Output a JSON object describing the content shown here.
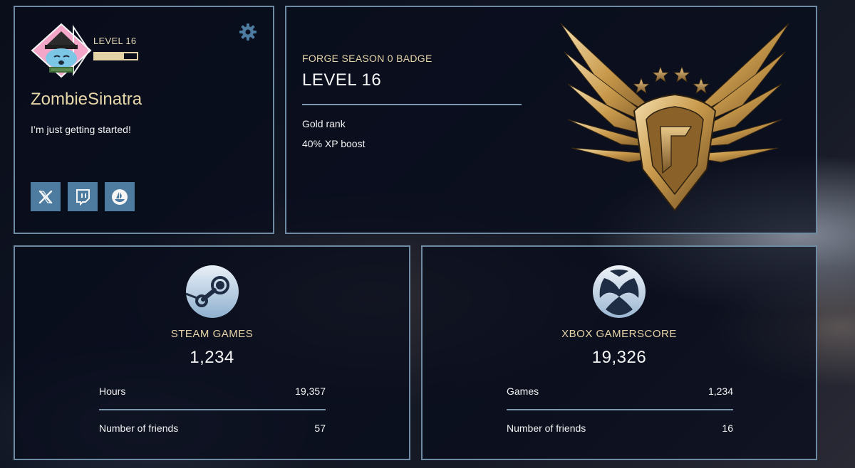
{
  "profile": {
    "level_label": "LEVEL 16",
    "xp_progress": 0.7,
    "username": "ZombieSinatra",
    "bio": "I’m just getting started!",
    "settings_icon": "gear-icon",
    "social_icons": [
      "x-icon",
      "twitch-icon",
      "opensea-icon"
    ]
  },
  "badge": {
    "season": "FORGE SEASON 0 BADGE",
    "level": "LEVEL 16",
    "rank": "Gold rank",
    "boost": "40% XP boost"
  },
  "steam": {
    "icon": "steam-icon",
    "label": "STEAM GAMES",
    "value": "1,234",
    "rows": [
      {
        "label": "Hours",
        "value": "19,357"
      },
      {
        "label": "Number of friends",
        "value": "57"
      }
    ]
  },
  "xbox": {
    "icon": "xbox-icon",
    "label": "XBOX GAMERSCORE",
    "value": "19,326",
    "rows": [
      {
        "label": "Games",
        "value": "1,234"
      },
      {
        "label": "Number of friends",
        "value": "16"
      }
    ]
  },
  "colors": {
    "accent_gold": "#e6d4a8",
    "panel_border": "#6f8aa3",
    "social_button": "#4d7ca0"
  }
}
